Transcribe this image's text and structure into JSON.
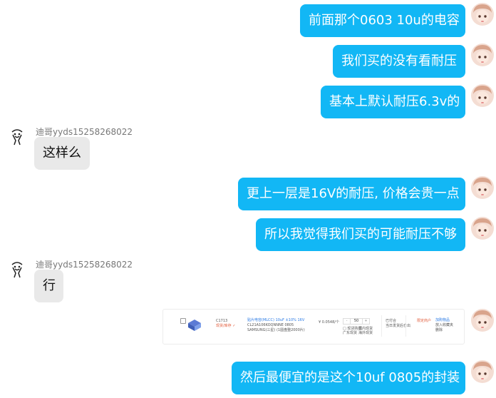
{
  "colors": {
    "outgoing_bubble": "#12b7f5",
    "incoming_bubble": "#e9e9e9"
  },
  "messages": [
    {
      "direction": "outgoing",
      "text": "前面那个0603 10u的电容"
    },
    {
      "direction": "outgoing",
      "text": "我们买的没有看耐压"
    },
    {
      "direction": "outgoing",
      "text": "基本上默认耐压6.3v的"
    },
    {
      "direction": "incoming",
      "sender": "迪哥yyds15258268022",
      "text": "这样么"
    },
    {
      "direction": "outgoing",
      "text": "更上一层是16V的耐压, 价格会贵一点"
    },
    {
      "direction": "outgoing",
      "text": "所以我觉得我们买的可能耐压不够"
    },
    {
      "direction": "incoming",
      "sender": "迪哥yyds15258268022",
      "text": "行"
    },
    {
      "direction": "outgoing",
      "type": "image",
      "card": {
        "code": "C1713",
        "brand": "现货/库存 ✓",
        "desc_line1": "贴片电容(MLCC) 10uF ±10% 16V",
        "desc_line2": "CL21A106KOQNNNE 0805",
        "desc_line3": "SAMSUNG(三星)  (1圆盘整2000片)",
        "price": "¥ 0.0548/个",
        "qty_minus": "-",
        "qty_value": "50",
        "qty_plus": "+",
        "opt1": "□ 现货购买",
        "opt2": "广东现货",
        "opt3": "国内现货",
        "opt4": "海外现货",
        "status": "已付合",
        "status_sub": "当日发货后仓出",
        "tag": "限定商户",
        "link1": "加购物品",
        "link2": "放入收藏夹",
        "link3": "删除"
      }
    },
    {
      "direction": "outgoing",
      "text": "然后最便宜的是这个10uf 0805的封装"
    }
  ]
}
